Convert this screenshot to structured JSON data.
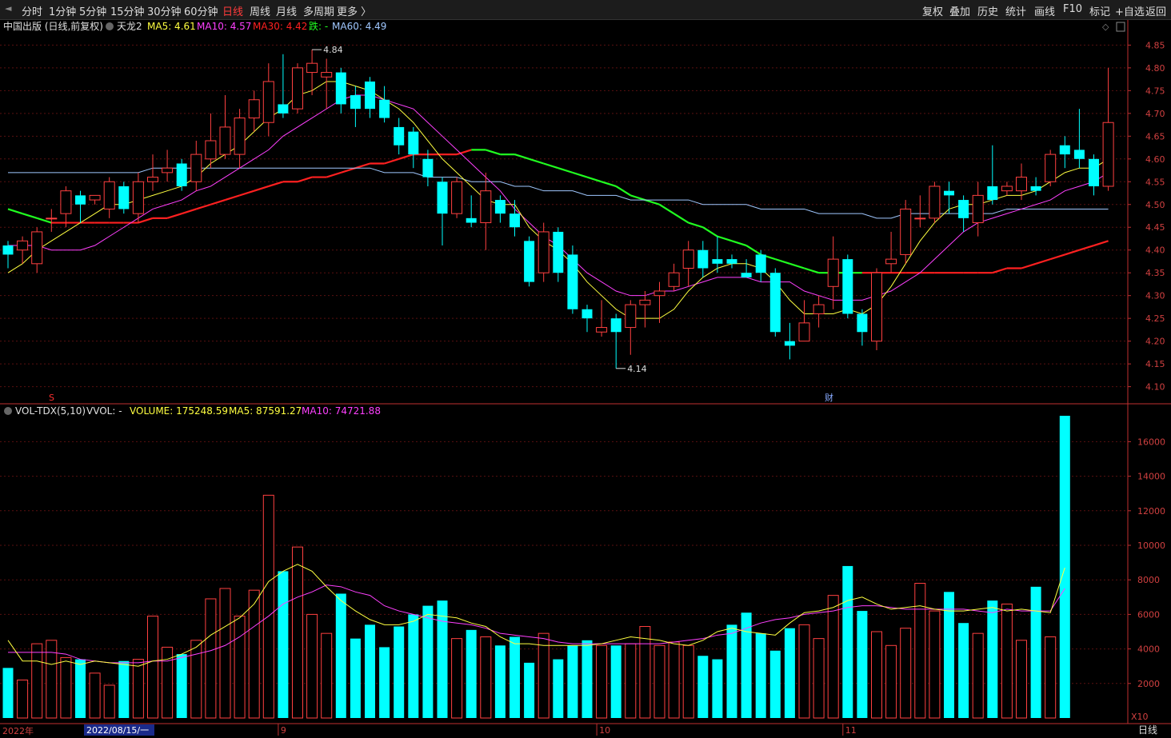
{
  "toolbar": {
    "left_items": [
      "分时",
      "1分钟",
      "5分钟",
      "15分钟",
      "30分钟",
      "60分钟",
      "日线",
      "周线",
      "月线",
      "多周期",
      "更多 〉"
    ],
    "active": "日线",
    "right_items": [
      "复权",
      "叠加",
      "历史",
      "统计",
      "画线",
      "F10",
      "标记",
      "+自选",
      "返回"
    ]
  },
  "price_panel": {
    "title": "中国出版 (日线,前复权)",
    "indicator": "天龙2",
    "ma5_label": "MA5: 4.61",
    "ma10_label": "MA10: 4.57",
    "ma30_label": "MA30: 4.42",
    "trend_label": "跌: -",
    "ma60_label": "MA60: 4.49",
    "high_annot": "4.84",
    "low_annot": "4.14",
    "marker_s": "S",
    "marker_cai": "财"
  },
  "volume_panel": {
    "header_name": "VOL-TDX(5,10)",
    "header_vvol": "VVOL: -",
    "volume_label": "VOLUME: 175248.59",
    "ma5_label": "MA5: 87591.27",
    "ma10_label": "MA10: 74721.88",
    "unit": "X10"
  },
  "bottom": {
    "year_label": "2022年",
    "date_label": "2022/08/15/一",
    "period_label": "日线",
    "months": [
      "9",
      "10",
      "11"
    ]
  },
  "colors": {
    "up": "#ff4040",
    "down": "#00ffff",
    "ma5": "#ffff40",
    "ma10": "#ff40ff",
    "ma30": "#ff2020",
    "ma30_alt": "#20ff20",
    "ma60": "#a0c8ff",
    "axis": "#c03030"
  },
  "chart_data": [
    {
      "type": "candlestick",
      "ylim": [
        4.08,
        4.87
      ],
      "yticks": [
        4.1,
        4.15,
        4.2,
        4.25,
        4.3,
        4.35,
        4.4,
        4.45,
        4.5,
        4.55,
        4.6,
        4.65,
        4.7,
        4.75,
        4.8,
        4.85
      ],
      "candles": [
        [
          4.41,
          4.39,
          4.42,
          4.36
        ],
        [
          4.4,
          4.42,
          4.43,
          4.37
        ],
        [
          4.37,
          4.44,
          4.45,
          4.35
        ],
        [
          4.47,
          4.47,
          4.49,
          4.44
        ],
        [
          4.48,
          4.53,
          4.54,
          4.45
        ],
        [
          4.52,
          4.5,
          4.53,
          4.46
        ],
        [
          4.51,
          4.52,
          4.52,
          4.5
        ],
        [
          4.49,
          4.55,
          4.56,
          4.47
        ],
        [
          4.54,
          4.49,
          4.55,
          4.48
        ],
        [
          4.48,
          4.55,
          4.57,
          4.46
        ],
        [
          4.55,
          4.56,
          4.61,
          4.53
        ],
        [
          4.57,
          4.58,
          4.62,
          4.55
        ],
        [
          4.59,
          4.54,
          4.6,
          4.53
        ],
        [
          4.55,
          4.61,
          4.64,
          4.53
        ],
        [
          4.6,
          4.64,
          4.7,
          4.58
        ],
        [
          4.61,
          4.67,
          4.74,
          4.6
        ],
        [
          4.61,
          4.69,
          4.71,
          4.58
        ],
        [
          4.69,
          4.73,
          4.75,
          4.66
        ],
        [
          4.68,
          4.77,
          4.81,
          4.65
        ],
        [
          4.72,
          4.7,
          4.83,
          4.69
        ],
        [
          4.71,
          4.8,
          4.81,
          4.7
        ],
        [
          4.79,
          4.81,
          4.84,
          4.74
        ],
        [
          4.78,
          4.79,
          4.82,
          4.71
        ],
        [
          4.79,
          4.72,
          4.8,
          4.7
        ],
        [
          4.74,
          4.71,
          4.76,
          4.67
        ],
        [
          4.77,
          4.71,
          4.78,
          4.69
        ],
        [
          4.73,
          4.69,
          4.76,
          4.68
        ],
        [
          4.67,
          4.63,
          4.69,
          4.61
        ],
        [
          4.66,
          4.61,
          4.67,
          4.58
        ],
        [
          4.6,
          4.56,
          4.62,
          4.54
        ],
        [
          4.55,
          4.48,
          4.56,
          4.41
        ],
        [
          4.48,
          4.55,
          4.56,
          4.47
        ],
        [
          4.47,
          4.46,
          4.52,
          4.45
        ],
        [
          4.46,
          4.53,
          4.57,
          4.4
        ],
        [
          4.51,
          4.48,
          4.52,
          4.46
        ],
        [
          4.48,
          4.45,
          4.51,
          4.43
        ],
        [
          4.42,
          4.33,
          4.43,
          4.32
        ],
        [
          4.35,
          4.44,
          4.46,
          4.33
        ],
        [
          4.44,
          4.35,
          4.45,
          4.33
        ],
        [
          4.39,
          4.27,
          4.41,
          4.26
        ],
        [
          4.27,
          4.25,
          4.28,
          4.22
        ],
        [
          4.22,
          4.23,
          4.29,
          4.21
        ],
        [
          4.25,
          4.22,
          4.26,
          4.14
        ],
        [
          4.23,
          4.28,
          4.29,
          4.17
        ],
        [
          4.28,
          4.29,
          4.31,
          4.23
        ],
        [
          4.3,
          4.31,
          4.33,
          4.24
        ],
        [
          4.32,
          4.35,
          4.37,
          4.31
        ],
        [
          4.36,
          4.4,
          4.42,
          4.32
        ],
        [
          4.4,
          4.36,
          4.42,
          4.34
        ],
        [
          4.38,
          4.37,
          4.43,
          4.35
        ],
        [
          4.38,
          4.37,
          4.39,
          4.36
        ],
        [
          4.35,
          4.34,
          4.38,
          4.34
        ],
        [
          4.39,
          4.35,
          4.4,
          4.33
        ],
        [
          4.35,
          4.22,
          4.36,
          4.21
        ],
        [
          4.2,
          4.19,
          4.24,
          4.16
        ],
        [
          4.2,
          4.24,
          4.29,
          4.2
        ],
        [
          4.26,
          4.28,
          4.3,
          4.23
        ],
        [
          4.32,
          4.38,
          4.43,
          4.27
        ],
        [
          4.38,
          4.26,
          4.39,
          4.25
        ],
        [
          4.26,
          4.22,
          4.27,
          4.19
        ],
        [
          4.2,
          4.35,
          4.36,
          4.18
        ],
        [
          4.37,
          4.38,
          4.44,
          4.35
        ],
        [
          4.39,
          4.49,
          4.51,
          4.37
        ],
        [
          4.47,
          4.47,
          4.52,
          4.45
        ],
        [
          4.47,
          4.54,
          4.55,
          4.46
        ],
        [
          4.53,
          4.52,
          4.55,
          4.48
        ],
        [
          4.51,
          4.47,
          4.52,
          4.44
        ],
        [
          4.46,
          4.52,
          4.55,
          4.43
        ],
        [
          4.54,
          4.51,
          4.63,
          4.5
        ],
        [
          4.53,
          4.54,
          4.55,
          4.52
        ],
        [
          4.53,
          4.56,
          4.59,
          4.51
        ],
        [
          4.54,
          4.53,
          4.56,
          4.52
        ],
        [
          4.55,
          4.61,
          4.62,
          4.54
        ],
        [
          4.63,
          4.61,
          4.65,
          4.58
        ],
        [
          4.62,
          4.6,
          4.71,
          4.58
        ],
        [
          4.6,
          4.54,
          4.61,
          4.52
        ],
        [
          4.54,
          4.68,
          4.8,
          4.53
        ]
      ],
      "ma5": [
        4.35,
        4.37,
        4.4,
        4.42,
        4.44,
        4.46,
        4.48,
        4.5,
        4.5,
        4.51,
        4.52,
        4.53,
        4.54,
        4.56,
        4.59,
        4.61,
        4.63,
        4.66,
        4.69,
        4.71,
        4.74,
        4.75,
        4.77,
        4.77,
        4.76,
        4.75,
        4.73,
        4.71,
        4.68,
        4.64,
        4.6,
        4.57,
        4.54,
        4.51,
        4.5,
        4.5,
        4.45,
        4.42,
        4.4,
        4.37,
        4.33,
        4.3,
        4.27,
        4.25,
        4.25,
        4.25,
        4.27,
        4.31,
        4.34,
        4.36,
        4.37,
        4.37,
        4.36,
        4.33,
        4.29,
        4.26,
        4.26,
        4.26,
        4.27,
        4.26,
        4.28,
        4.32,
        4.37,
        4.42,
        4.46,
        4.49,
        4.5,
        4.5,
        4.51,
        4.52,
        4.52,
        4.53,
        4.55,
        4.57,
        4.58,
        4.58,
        4.6
      ],
      "ma10": [
        4.41,
        4.41,
        4.41,
        4.4,
        4.4,
        4.4,
        4.41,
        4.43,
        4.45,
        4.47,
        4.49,
        4.5,
        4.51,
        4.53,
        4.54,
        4.56,
        4.58,
        4.6,
        4.62,
        4.65,
        4.67,
        4.69,
        4.71,
        4.73,
        4.74,
        4.74,
        4.73,
        4.72,
        4.71,
        4.68,
        4.65,
        4.62,
        4.59,
        4.56,
        4.53,
        4.49,
        4.46,
        4.43,
        4.41,
        4.38,
        4.35,
        4.33,
        4.31,
        4.3,
        4.3,
        4.31,
        4.31,
        4.32,
        4.33,
        4.34,
        4.34,
        4.34,
        4.33,
        4.33,
        4.33,
        4.31,
        4.3,
        4.29,
        4.29,
        4.29,
        4.3,
        4.31,
        4.33,
        4.35,
        4.38,
        4.41,
        4.44,
        4.46,
        4.47,
        4.48,
        4.49,
        4.5,
        4.51,
        4.53,
        4.54,
        4.55,
        4.57
      ],
      "ma30": [
        4.49,
        4.48,
        4.47,
        4.46,
        4.46,
        4.46,
        4.46,
        4.46,
        4.46,
        4.46,
        4.47,
        4.47,
        4.48,
        4.49,
        4.5,
        4.51,
        4.52,
        4.53,
        4.54,
        4.55,
        4.55,
        4.56,
        4.56,
        4.57,
        4.58,
        4.59,
        4.59,
        4.6,
        4.61,
        4.61,
        4.61,
        4.61,
        4.62,
        4.62,
        4.61,
        4.61,
        4.6,
        4.59,
        4.58,
        4.57,
        4.56,
        4.55,
        4.54,
        4.52,
        4.51,
        4.5,
        4.48,
        4.46,
        4.45,
        4.43,
        4.42,
        4.41,
        4.39,
        4.38,
        4.37,
        4.36,
        4.35,
        4.35,
        4.35,
        4.35,
        4.35,
        4.35,
        4.35,
        4.35,
        4.35,
        4.35,
        4.35,
        4.35,
        4.35,
        4.36,
        4.36,
        4.37,
        4.38,
        4.39,
        4.4,
        4.41,
        4.42
      ],
      "ma60": [
        4.57,
        4.57,
        4.57,
        4.57,
        4.57,
        4.57,
        4.57,
        4.57,
        4.57,
        4.57,
        4.58,
        4.58,
        4.58,
        4.58,
        4.58,
        4.58,
        4.58,
        4.58,
        4.58,
        4.58,
        4.58,
        4.58,
        4.58,
        4.58,
        4.58,
        4.58,
        4.57,
        4.57,
        4.57,
        4.56,
        4.56,
        4.56,
        4.55,
        4.55,
        4.55,
        4.54,
        4.54,
        4.53,
        4.53,
        4.53,
        4.52,
        4.52,
        4.52,
        4.51,
        4.51,
        4.51,
        4.51,
        4.51,
        4.5,
        4.5,
        4.5,
        4.5,
        4.49,
        4.49,
        4.49,
        4.49,
        4.48,
        4.48,
        4.48,
        4.48,
        4.47,
        4.47,
        4.48,
        4.48,
        4.48,
        4.48,
        4.48,
        4.48,
        4.48,
        4.49,
        4.49,
        4.49,
        4.49,
        4.49,
        4.49,
        4.49,
        4.49
      ]
    },
    {
      "type": "bar",
      "title": "VOL-TDX(5,10)",
      "unit": "X10",
      "ylim": [
        0,
        17500
      ],
      "yticks": [
        2000,
        4000,
        6000,
        8000,
        10000,
        12000,
        14000,
        16000
      ],
      "volumes": [
        2900,
        2200,
        4300,
        4500,
        3500,
        3400,
        2600,
        1900,
        3300,
        3400,
        5900,
        4100,
        3700,
        4500,
        6900,
        7500,
        5900,
        7400,
        12900,
        8500,
        9900,
        6000,
        4900,
        7200,
        4600,
        5400,
        4100,
        5300,
        6000,
        6500,
        6800,
        4600,
        5100,
        4700,
        4200,
        4700,
        3200,
        4900,
        3400,
        4200,
        4500,
        4200,
        4200,
        4300,
        5300,
        4200,
        4400,
        4200,
        3600,
        3400,
        5400,
        6100,
        4900,
        3900,
        5200,
        5400,
        4600,
        7100,
        8800,
        6200,
        5000,
        4200,
        5200,
        7800,
        6200,
        7300,
        5500,
        4900,
        6800,
        6600,
        4500,
        7600,
        4700,
        17500
      ],
      "ma5": [
        4500,
        3300,
        3300,
        3100,
        3300,
        3100,
        3300,
        3200,
        3100,
        3000,
        3300,
        3400,
        3700,
        4100,
        4800,
        5300,
        5800,
        6600,
        7900,
        8500,
        8900,
        8500,
        7600,
        6800,
        6200,
        5700,
        5400,
        5400,
        5600,
        6000,
        5900,
        5800,
        5500,
        5300,
        4700,
        4300,
        4300,
        4200,
        4200,
        4200,
        4200,
        4300,
        4500,
        4700,
        4600,
        4500,
        4300,
        4200,
        4500,
        5000,
        5200,
        5000,
        4900,
        4800,
        5500,
        6100,
        6200,
        6400,
        6800,
        7000,
        6600,
        6300,
        6400,
        6500,
        6300,
        6200,
        6200,
        6300,
        6400,
        6200,
        6300,
        6200,
        6100,
        8700
      ],
      "ma10": [
        3800,
        3800,
        3800,
        3800,
        3700,
        3400,
        3300,
        3200,
        3200,
        3200,
        3300,
        3300,
        3500,
        3700,
        3900,
        4200,
        4700,
        5300,
        5900,
        6600,
        7000,
        7300,
        7700,
        7600,
        7300,
        7100,
        6500,
        6200,
        6000,
        5800,
        5600,
        5500,
        5400,
        5200,
        4900,
        4800,
        4700,
        4600,
        4400,
        4300,
        4300,
        4300,
        4300,
        4300,
        4300,
        4300,
        4400,
        4500,
        4600,
        4800,
        4900,
        5200,
        5500,
        5700,
        5800,
        6000,
        6100,
        6200,
        6400,
        6500,
        6500,
        6400,
        6300,
        6300,
        6300,
        6300,
        6300,
        6200,
        6100,
        6300,
        6200,
        6200,
        6200,
        7500
      ]
    }
  ]
}
